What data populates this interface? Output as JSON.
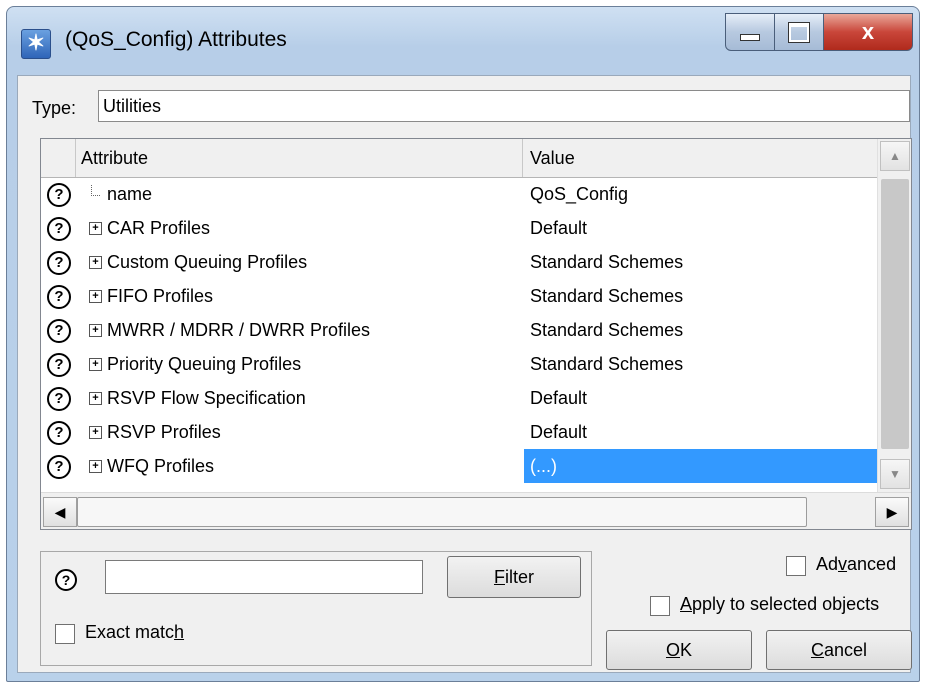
{
  "window": {
    "title": "(QoS_Config) Attributes",
    "close_glyph": "x"
  },
  "type_row": {
    "label": "Type:",
    "value": "Utilities"
  },
  "grid": {
    "columns": {
      "attribute": "Attribute",
      "value": "Value"
    },
    "rows": [
      {
        "attribute": "name",
        "value": "QoS_Config",
        "expandable": false,
        "selected": false
      },
      {
        "attribute": "CAR Profiles",
        "value": "Default",
        "expandable": true,
        "selected": false
      },
      {
        "attribute": "Custom Queuing Profiles",
        "value": "Standard Schemes",
        "expandable": true,
        "selected": false
      },
      {
        "attribute": "FIFO Profiles",
        "value": "Standard Schemes",
        "expandable": true,
        "selected": false
      },
      {
        "attribute": "MWRR / MDRR / DWRR Profiles",
        "value": "Standard Schemes",
        "expandable": true,
        "selected": false
      },
      {
        "attribute": "Priority Queuing Profiles",
        "value": "Standard Schemes",
        "expandable": true,
        "selected": false
      },
      {
        "attribute": "RSVP Flow Specification",
        "value": "Default",
        "expandable": true,
        "selected": false
      },
      {
        "attribute": "RSVP Profiles",
        "value": "Default",
        "expandable": true,
        "selected": false
      },
      {
        "attribute": "WFQ Profiles",
        "value": "(...)",
        "expandable": true,
        "selected": true
      }
    ],
    "help_glyph": "?",
    "expand_glyph": "+"
  },
  "filter": {
    "help_glyph": "?",
    "input_value": "",
    "button_prefix": "",
    "button_mnemonic": "F",
    "button_rest": "ilter",
    "exact_prefix": "Exact matc",
    "exact_mnemonic": "h",
    "exact_checked": false
  },
  "options": {
    "advanced_prefix": "Ad",
    "advanced_mnemonic": "v",
    "advanced_rest": "anced",
    "advanced_checked": false,
    "apply_mnemonic": "A",
    "apply_rest": "pply to selected objects",
    "apply_checked": false
  },
  "buttons": {
    "ok_mnemonic": "O",
    "ok_rest": "K",
    "cancel_mnemonic": "C",
    "cancel_rest": "ancel"
  },
  "colors": {
    "selection": "#3399ff",
    "close_button": "#c9463a"
  },
  "icons": [
    "app-icon",
    "minimize-icon",
    "maximize-icon",
    "close-icon",
    "help-icon",
    "expand-icon",
    "scroll-up-icon",
    "scroll-down-icon",
    "scroll-left-icon",
    "scroll-right-icon"
  ]
}
